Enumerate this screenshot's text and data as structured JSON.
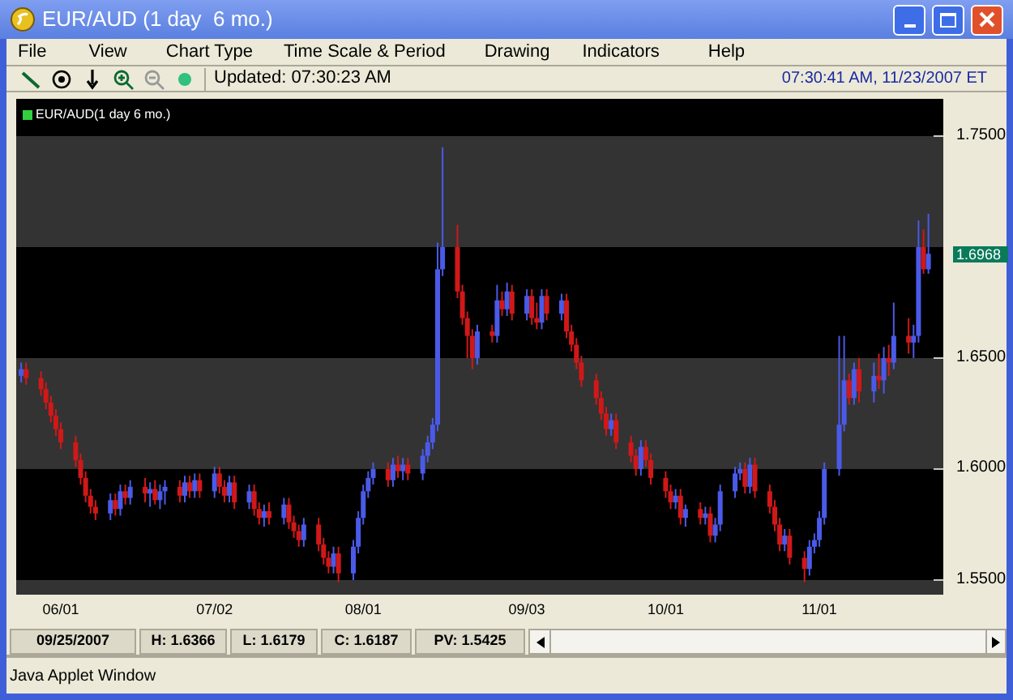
{
  "window": {
    "title": "EUR/AUD (1 day  6 mo.)"
  },
  "menu": [
    "File",
    "View",
    "Chart Type",
    "Time Scale & Period",
    "Drawing",
    "Indicators",
    "Help"
  ],
  "toolbar": {
    "updated": "Updated: 07:30:23 AM",
    "clock": "07:30:41 AM, 11/23/2007 ET"
  },
  "chart": {
    "legend": "EUR/AUD(1 day 6 mo.)",
    "last_price": "1.6968",
    "chart_data": {
      "type": "candlestick",
      "x": [
        "2007-05-24",
        "2007-05-25",
        "2007-05-28",
        "2007-05-29",
        "2007-05-30",
        "2007-05-31",
        "2007-06-01",
        "2007-06-04",
        "2007-06-05",
        "2007-06-06",
        "2007-06-07",
        "2007-06-08",
        "2007-06-11",
        "2007-06-12",
        "2007-06-13",
        "2007-06-14",
        "2007-06-15",
        "2007-06-18",
        "2007-06-19",
        "2007-06-20",
        "2007-06-21",
        "2007-06-22",
        "2007-06-25",
        "2007-06-26",
        "2007-06-27",
        "2007-06-28",
        "2007-06-29",
        "2007-07-02",
        "2007-07-03",
        "2007-07-04",
        "2007-07-05",
        "2007-07-06",
        "2007-07-09",
        "2007-07-10",
        "2007-07-11",
        "2007-07-12",
        "2007-07-13",
        "2007-07-16",
        "2007-07-17",
        "2007-07-18",
        "2007-07-19",
        "2007-07-20",
        "2007-07-23",
        "2007-07-24",
        "2007-07-25",
        "2007-07-26",
        "2007-07-27",
        "2007-07-30",
        "2007-07-31",
        "2007-08-01",
        "2007-08-02",
        "2007-08-03",
        "2007-08-06",
        "2007-08-07",
        "2007-08-08",
        "2007-08-09",
        "2007-08-10",
        "2007-08-13",
        "2007-08-14",
        "2007-08-15",
        "2007-08-16",
        "2007-08-17",
        "2007-08-20",
        "2007-08-21",
        "2007-08-22",
        "2007-08-23",
        "2007-08-24",
        "2007-08-27",
        "2007-08-28",
        "2007-08-29",
        "2007-08-30",
        "2007-08-31",
        "2007-09-03",
        "2007-09-04",
        "2007-09-05",
        "2007-09-06",
        "2007-09-07",
        "2007-09-10",
        "2007-09-11",
        "2007-09-12",
        "2007-09-13",
        "2007-09-14",
        "2007-09-17",
        "2007-09-18",
        "2007-09-19",
        "2007-09-20",
        "2007-09-21",
        "2007-09-24",
        "2007-09-25",
        "2007-09-26",
        "2007-09-27",
        "2007-09-28",
        "2007-10-01",
        "2007-10-02",
        "2007-10-03",
        "2007-10-04",
        "2007-10-05",
        "2007-10-08",
        "2007-10-09",
        "2007-10-10",
        "2007-10-11",
        "2007-10-12",
        "2007-10-15",
        "2007-10-16",
        "2007-10-17",
        "2007-10-18",
        "2007-10-19",
        "2007-10-22",
        "2007-10-23",
        "2007-10-24",
        "2007-10-25",
        "2007-10-26",
        "2007-10-29",
        "2007-10-30",
        "2007-10-31",
        "2007-11-01",
        "2007-11-02",
        "2007-11-05",
        "2007-11-06",
        "2007-11-07",
        "2007-11-08",
        "2007-11-09",
        "2007-11-12",
        "2007-11-13",
        "2007-11-14",
        "2007-11-15",
        "2007-11-16",
        "2007-11-19",
        "2007-11-20",
        "2007-11-21",
        "2007-11-22",
        "2007-11-23"
      ],
      "xticks": [
        {
          "value": "2007-06-01",
          "label": "06/01"
        },
        {
          "value": "2007-07-02",
          "label": "07/02"
        },
        {
          "value": "2007-08-01",
          "label": "08/01"
        },
        {
          "value": "2007-09-03",
          "label": "09/03"
        },
        {
          "value": "2007-10-01",
          "label": "10/01"
        },
        {
          "value": "2007-11-01",
          "label": "11/01"
        }
      ],
      "xlim": [
        "2007-05-23",
        "2007-11-26"
      ],
      "ylim": [
        1.5434,
        1.7668
      ],
      "bands": [
        {
          "axis": "y",
          "from": 1.7,
          "to": 1.75
        },
        {
          "axis": "y",
          "from": 1.6,
          "to": 1.65
        },
        {
          "axis": "y",
          "from": 1.5,
          "to": 1.55
        }
      ],
      "yticks": [
        {
          "value": 1.75,
          "label": "1.7500"
        },
        {
          "value": 1.65,
          "label": "1.6500"
        },
        {
          "value": 1.6,
          "label": "1.6000"
        },
        {
          "value": 1.55,
          "label": "1.5500"
        }
      ],
      "ohlc": [
        [
          1.642,
          1.648,
          1.639,
          1.645
        ],
        [
          1.645,
          1.648,
          1.638,
          1.641
        ],
        [
          1.641,
          1.644,
          1.633,
          1.636
        ],
        [
          1.636,
          1.639,
          1.627,
          1.63
        ],
        [
          1.63,
          1.633,
          1.621,
          1.624
        ],
        [
          1.624,
          1.627,
          1.615,
          1.618
        ],
        [
          1.618,
          1.621,
          1.609,
          1.612
        ],
        [
          1.612,
          1.615,
          1.601,
          1.604
        ],
        [
          1.604,
          1.607,
          1.593,
          1.596
        ],
        [
          1.596,
          1.599,
          1.585,
          1.588
        ],
        [
          1.588,
          1.591,
          1.58,
          1.583
        ],
        [
          1.583,
          1.586,
          1.577,
          1.58
        ],
        [
          1.58,
          1.589,
          1.577,
          1.586
        ],
        [
          1.586,
          1.589,
          1.579,
          1.582
        ],
        [
          1.582,
          1.593,
          1.579,
          1.59
        ],
        [
          1.59,
          1.593,
          1.584,
          1.587
        ],
        [
          1.587,
          1.595,
          1.584,
          1.592
        ],
        [
          1.592,
          1.596,
          1.585,
          1.589
        ],
        [
          1.589,
          1.594,
          1.583,
          1.591
        ],
        [
          1.591,
          1.595,
          1.584,
          1.586
        ],
        [
          1.586,
          1.593,
          1.582,
          1.59
        ],
        [
          1.59,
          1.595,
          1.584,
          1.592
        ],
        [
          1.592,
          1.595,
          1.585,
          1.588
        ],
        [
          1.588,
          1.597,
          1.585,
          1.594
        ],
        [
          1.594,
          1.597,
          1.587,
          1.59
        ],
        [
          1.59,
          1.598,
          1.587,
          1.595
        ],
        [
          1.595,
          1.598,
          1.587,
          1.59
        ],
        [
          1.59,
          1.601,
          1.587,
          1.598
        ],
        [
          1.598,
          1.601,
          1.589,
          1.592
        ],
        [
          1.592,
          1.595,
          1.585,
          1.588
        ],
        [
          1.588,
          1.597,
          1.585,
          1.594
        ],
        [
          1.594,
          1.597,
          1.582,
          1.585
        ],
        [
          1.585,
          1.593,
          1.582,
          1.59
        ],
        [
          1.59,
          1.593,
          1.579,
          1.582
        ],
        [
          1.582,
          1.585,
          1.575,
          1.578
        ],
        [
          1.578,
          1.584,
          1.574,
          1.581
        ],
        [
          1.581,
          1.585,
          1.575,
          1.578
        ],
        [
          1.578,
          1.587,
          1.575,
          1.584
        ],
        [
          1.584,
          1.587,
          1.573,
          1.576
        ],
        [
          1.576,
          1.579,
          1.569,
          1.572
        ],
        [
          1.572,
          1.575,
          1.565,
          1.568
        ],
        [
          1.568,
          1.578,
          1.565,
          1.575
        ],
        [
          1.575,
          1.578,
          1.563,
          1.566
        ],
        [
          1.566,
          1.569,
          1.557,
          1.56
        ],
        [
          1.56,
          1.563,
          1.553,
          1.556
        ],
        [
          1.556,
          1.565,
          1.553,
          1.562
        ],
        [
          1.562,
          1.565,
          1.549,
          1.553
        ],
        [
          1.553,
          1.568,
          1.55,
          1.565
        ],
        [
          1.565,
          1.581,
          1.562,
          1.578
        ],
        [
          1.578,
          1.593,
          1.575,
          1.59
        ],
        [
          1.59,
          1.599,
          1.587,
          1.596
        ],
        [
          1.596,
          1.603,
          1.593,
          1.6
        ],
        [
          1.6,
          1.603,
          1.592,
          1.595
        ],
        [
          1.595,
          1.605,
          1.592,
          1.602
        ],
        [
          1.602,
          1.606,
          1.596,
          1.599
        ],
        [
          1.599,
          1.605,
          1.595,
          1.602
        ],
        [
          1.602,
          1.605,
          1.595,
          1.598
        ],
        [
          1.598,
          1.609,
          1.595,
          1.606
        ],
        [
          1.606,
          1.615,
          1.603,
          1.612
        ],
        [
          1.612,
          1.623,
          1.609,
          1.62
        ],
        [
          1.62,
          1.702,
          1.617,
          1.69
        ],
        [
          1.69,
          1.745,
          1.687,
          1.7
        ],
        [
          1.7,
          1.71,
          1.677,
          1.68
        ],
        [
          1.68,
          1.683,
          1.665,
          1.668
        ],
        [
          1.668,
          1.671,
          1.65,
          1.66
        ],
        [
          1.66,
          1.663,
          1.645,
          1.65
        ],
        [
          1.65,
          1.665,
          1.647,
          1.662
        ],
        [
          1.662,
          1.665,
          1.657,
          1.66
        ],
        [
          1.66,
          1.683,
          1.657,
          1.676
        ],
        [
          1.676,
          1.68,
          1.669,
          1.672
        ],
        [
          1.672,
          1.684,
          1.669,
          1.68
        ],
        [
          1.68,
          1.683,
          1.667,
          1.67
        ],
        [
          1.67,
          1.681,
          1.667,
          1.678
        ],
        [
          1.678,
          1.681,
          1.665,
          1.668
        ],
        [
          1.668,
          1.675,
          1.663,
          1.666
        ],
        [
          1.666,
          1.681,
          1.663,
          1.678
        ],
        [
          1.678,
          1.681,
          1.667,
          1.67
        ],
        [
          1.67,
          1.679,
          1.667,
          1.676
        ],
        [
          1.676,
          1.679,
          1.659,
          1.662
        ],
        [
          1.662,
          1.665,
          1.653,
          1.656
        ],
        [
          1.656,
          1.659,
          1.645,
          1.648
        ],
        [
          1.648,
          1.651,
          1.637,
          1.64
        ],
        [
          1.64,
          1.643,
          1.629,
          1.632
        ],
        [
          1.632,
          1.635,
          1.622,
          1.625
        ],
        [
          1.625,
          1.628,
          1.615,
          1.618
        ],
        [
          1.618,
          1.625,
          1.615,
          1.622
        ],
        [
          1.622,
          1.625,
          1.609,
          1.612
        ],
        [
          1.612,
          1.615,
          1.603,
          1.606
        ],
        [
          1.606,
          1.609,
          1.597,
          1.6
        ],
        [
          1.6,
          1.613,
          1.597,
          1.61
        ],
        [
          1.61,
          1.613,
          1.601,
          1.604
        ],
        [
          1.604,
          1.607,
          1.593,
          1.596
        ],
        [
          1.596,
          1.599,
          1.587,
          1.59
        ],
        [
          1.59,
          1.593,
          1.582,
          1.585
        ],
        [
          1.585,
          1.591,
          1.582,
          1.588
        ],
        [
          1.588,
          1.591,
          1.575,
          1.578
        ],
        [
          1.578,
          1.584,
          1.574,
          1.582
        ],
        [
          1.582,
          1.585,
          1.575,
          1.578
        ],
        [
          1.578,
          1.583,
          1.575,
          1.58
        ],
        [
          1.58,
          1.583,
          1.567,
          1.57
        ],
        [
          1.57,
          1.578,
          1.567,
          1.575
        ],
        [
          1.575,
          1.593,
          1.572,
          1.59
        ],
        [
          1.59,
          1.601,
          1.587,
          1.598
        ],
        [
          1.598,
          1.603,
          1.595,
          1.6
        ],
        [
          1.6,
          1.603,
          1.589,
          1.592
        ],
        [
          1.592,
          1.605,
          1.589,
          1.602
        ],
        [
          1.602,
          1.605,
          1.587,
          1.59
        ],
        [
          1.59,
          1.593,
          1.58,
          1.583
        ],
        [
          1.583,
          1.586,
          1.572,
          1.575
        ],
        [
          1.575,
          1.578,
          1.563,
          1.566
        ],
        [
          1.566,
          1.573,
          1.563,
          1.57
        ],
        [
          1.57,
          1.573,
          1.557,
          1.56
        ],
        [
          1.56,
          1.563,
          1.549,
          1.555
        ],
        [
          1.555,
          1.568,
          1.552,
          1.565
        ],
        [
          1.565,
          1.571,
          1.562,
          1.568
        ],
        [
          1.568,
          1.581,
          1.565,
          1.578
        ],
        [
          1.578,
          1.603,
          1.575,
          1.6
        ],
        [
          1.6,
          1.66,
          1.597,
          1.62
        ],
        [
          1.62,
          1.66,
          1.617,
          1.64
        ],
        [
          1.64,
          1.643,
          1.629,
          1.632
        ],
        [
          1.632,
          1.648,
          1.629,
          1.645
        ],
        [
          1.645,
          1.65,
          1.63,
          1.635
        ],
        [
          1.635,
          1.648,
          1.63,
          1.642
        ],
        [
          1.642,
          1.652,
          1.636,
          1.64
        ],
        [
          1.64,
          1.655,
          1.634,
          1.65
        ],
        [
          1.65,
          1.656,
          1.642,
          1.648
        ],
        [
          1.648,
          1.675,
          1.645,
          1.66
        ],
        [
          1.66,
          1.668,
          1.652,
          1.657
        ],
        [
          1.657,
          1.665,
          1.65,
          1.66
        ],
        [
          1.66,
          1.712,
          1.657,
          1.7
        ],
        [
          1.7,
          1.708,
          1.688,
          1.69
        ],
        [
          1.69,
          1.715,
          1.688,
          1.697
        ]
      ]
    }
  },
  "status": [
    "09/25/2007",
    "H: 1.6366",
    "L: 1.6179",
    "C: 1.6187",
    "PV: 1.5425"
  ],
  "footer": "Java Applet Window"
}
